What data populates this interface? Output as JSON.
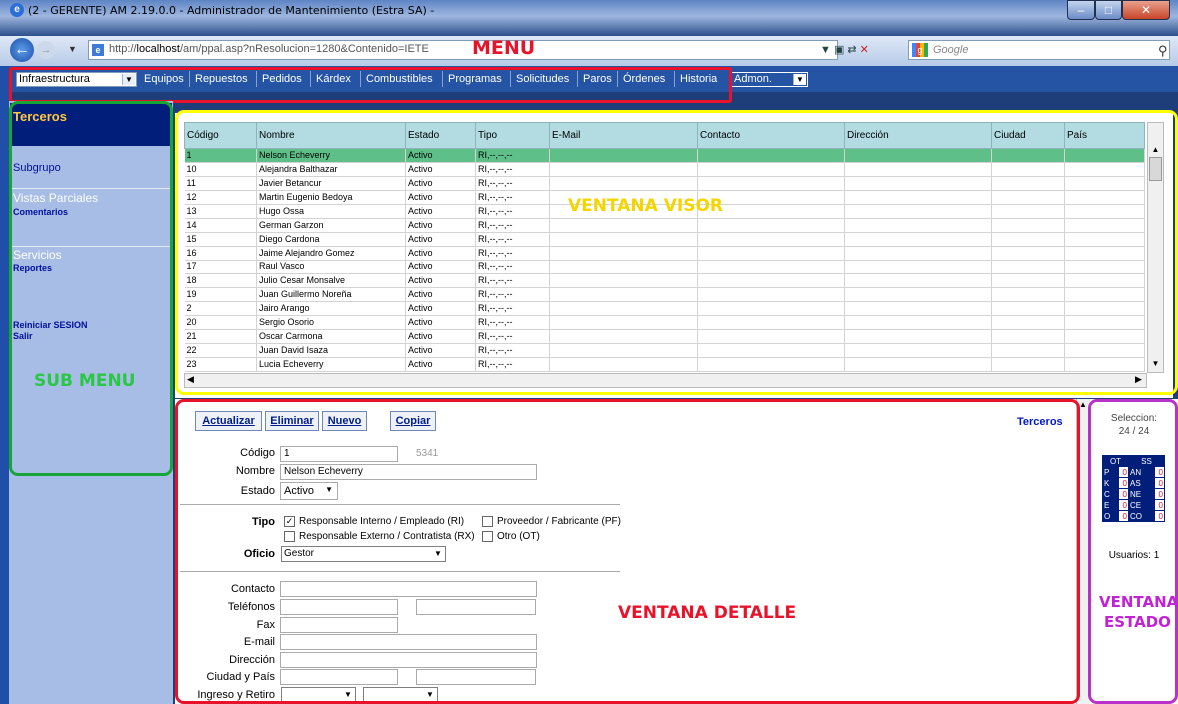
{
  "window": {
    "title": "(2 - GERENTE) AM 2.19.0.0 - Administrador de Mantenimiento (Estra SA) -"
  },
  "browser": {
    "url_prefix": "http://",
    "url_host": "localhost",
    "url_path": "/am/ppal.asp?nResolucion=1280&Contenido=IETE",
    "search_placeholder": "Google"
  },
  "annotations": {
    "menu": "MENU",
    "submenu": "SUB MENU",
    "visor": "VENTANA VISOR",
    "detalle": "VENTANA DETALLE",
    "estado_line1": "VENTANA",
    "estado_line2": "ESTADO"
  },
  "menu": {
    "select_left": "Infraestructura",
    "items": [
      "Equipos",
      "Repuestos",
      "Pedidos",
      "Kárdex",
      "Combustibles",
      "Programas",
      "Solicitudes",
      "Paros",
      "Órdenes",
      "Historia"
    ],
    "select_right": "Admon."
  },
  "submenu": {
    "title": "Terceros",
    "subgrupo": "Subgrupo",
    "vistas": "Vistas Parciales",
    "comentarios": "Comentarios",
    "servicios": "Servicios",
    "reportes": "Reportes",
    "reiniciar": "Reiniciar SESION",
    "salir": "Salir"
  },
  "grid": {
    "columns": [
      "Código",
      "Nombre",
      "Estado",
      "Tipo",
      "E-Mail",
      "Contacto",
      "Dirección",
      "Ciudad",
      "País"
    ],
    "rows": [
      [
        "1",
        "Nelson Echeverry",
        "Activo",
        "RI,--,--,--"
      ],
      [
        "10",
        "Alejandra Balthazar",
        "Activo",
        "RI,--,--,--"
      ],
      [
        "11",
        "Javier Betancur",
        "Activo",
        "RI,--,--,--"
      ],
      [
        "12",
        "Martin Eugenio Bedoya",
        "Activo",
        "RI,--,--,--"
      ],
      [
        "13",
        "Hugo Ossa",
        "Activo",
        "RI,--,--,--"
      ],
      [
        "14",
        "German Garzon",
        "Activo",
        "RI,--,--,--"
      ],
      [
        "15",
        "Diego Cardona",
        "Activo",
        "RI,--,--,--"
      ],
      [
        "16",
        "Jaime Alejandro Gomez",
        "Activo",
        "RI,--,--,--"
      ],
      [
        "17",
        "Raul Vasco",
        "Activo",
        "RI,--,--,--"
      ],
      [
        "18",
        "Julio Cesar Monsalve",
        "Activo",
        "RI,--,--,--"
      ],
      [
        "19",
        "Juan Guillermo Noreña",
        "Activo",
        "RI,--,--,--"
      ],
      [
        "2",
        "Jairo Arango",
        "Activo",
        "RI,--,--,--"
      ],
      [
        "20",
        "Sergio Osorio",
        "Activo",
        "RI,--,--,--"
      ],
      [
        "21",
        "Oscar Carmona",
        "Activo",
        "RI,--,--,--"
      ],
      [
        "22",
        "Juan David Isaza",
        "Activo",
        "RI,--,--,--"
      ],
      [
        "23",
        "Lucia Echeverry",
        "Activo",
        "RI,--,--,--"
      ]
    ]
  },
  "detail": {
    "buttons": {
      "actualizar": "Actualizar",
      "eliminar": "Eliminar",
      "nuevo": "Nuevo",
      "copiar": "Copiar"
    },
    "title": "Terceros",
    "labels": {
      "codigo": "Código",
      "nombre": "Nombre",
      "estado": "Estado",
      "tipo": "Tipo",
      "oficio": "Oficio",
      "contacto": "Contacto",
      "telefonos": "Teléfonos",
      "fax": "Fax",
      "email": "E-mail",
      "direccion": "Dirección",
      "ciudad_pais": "Ciudad y País",
      "ingreso_retiro": "Ingreso y Retiro"
    },
    "values": {
      "codigo": "1",
      "id_number": "5341",
      "nombre": "Nelson Echeverry",
      "estado": "Activo",
      "oficio": "Gestor"
    },
    "tipo_options": {
      "ri": "Responsable Interno / Empleado (RI)",
      "pf": "Proveedor / Fabricante (PF)",
      "rx": "Responsable Externo / Contratista (RX)",
      "ot": "Otro (OT)"
    }
  },
  "status": {
    "seleccion_label": "Seleccion:",
    "seleccion_value": "24 / 24",
    "ot_header": "OT",
    "ss_header": "SS",
    "ot_rows": [
      {
        "label": "P",
        "value": "0",
        "ss_label": "AN",
        "ss_value": "0"
      },
      {
        "label": "K",
        "value": "0",
        "ss_label": "AS",
        "ss_value": "0"
      },
      {
        "label": "C",
        "value": "0",
        "ss_label": "NE",
        "ss_value": "0"
      },
      {
        "label": "E",
        "value": "0",
        "ss_label": "CE",
        "ss_value": "0"
      },
      {
        "label": "O",
        "value": "0",
        "ss_label": "CO",
        "ss_value": "0"
      }
    ],
    "usuarios": "Usuarios: 1"
  }
}
